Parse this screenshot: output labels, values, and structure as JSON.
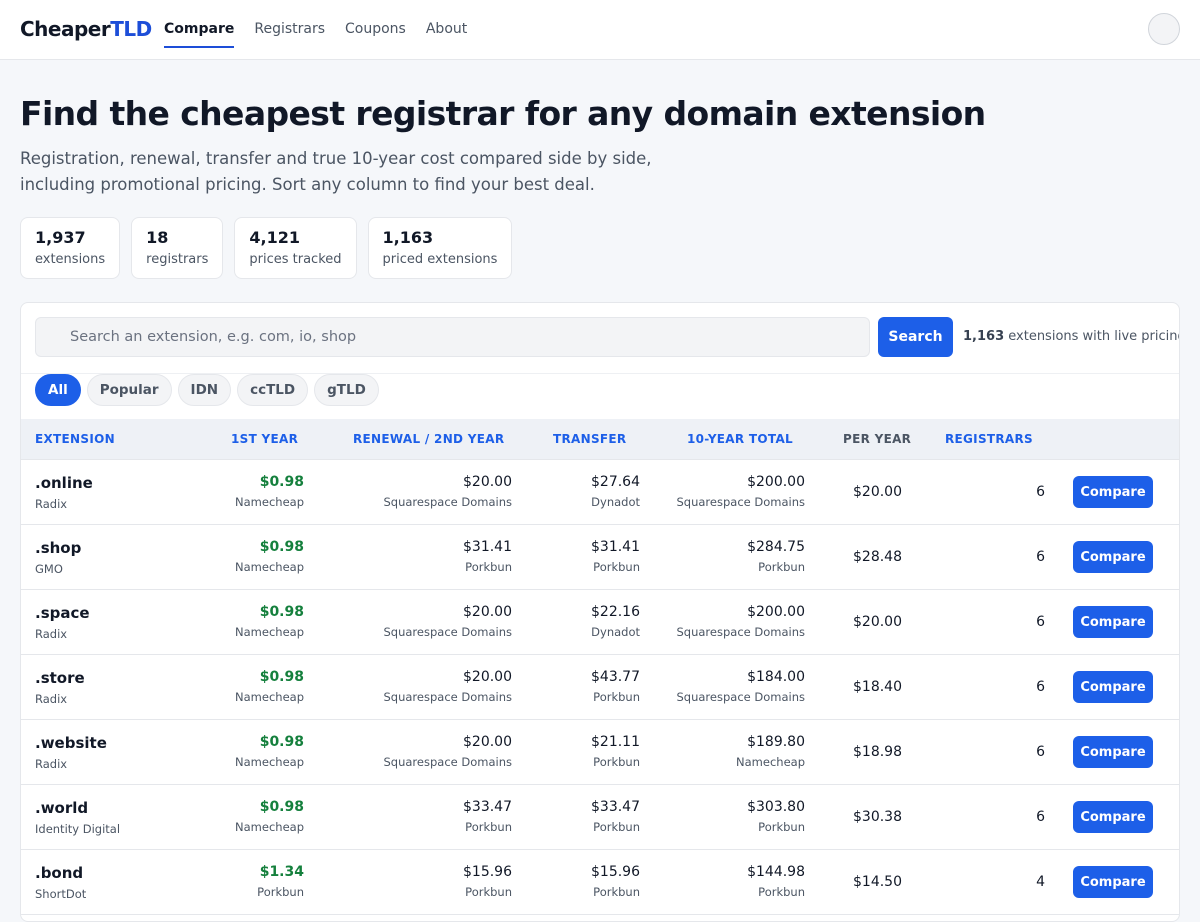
{
  "app": {
    "logo_part1": "Cheaper",
    "logo_part2": "TLD",
    "nav": [
      {
        "label": "Compare",
        "active": true
      },
      {
        "label": "Registrars",
        "active": false
      },
      {
        "label": "Coupons",
        "active": false
      },
      {
        "label": "About",
        "active": false
      }
    ]
  },
  "hero": {
    "title": "Find the cheapest registrar for any domain extension",
    "subtitle_line1": "Registration, renewal, transfer and true 10-year cost compared side by side,",
    "subtitle_line2": "including promotional pricing. Sort any column to find your best deal."
  },
  "stats": [
    {
      "value": "1,937",
      "label": "extensions"
    },
    {
      "value": "18",
      "label": "registrars"
    },
    {
      "value": "4,121",
      "label": "prices tracked"
    },
    {
      "value": "1,163",
      "label": "priced extensions"
    }
  ],
  "search": {
    "placeholder": "Search an extension, e.g. com, io, shop",
    "button_label": "Search",
    "live_count": "1,163",
    "live_text": " extensions with live pricing"
  },
  "filters": [
    {
      "label": "All",
      "active": true
    },
    {
      "label": "Popular",
      "active": false
    },
    {
      "label": "IDN",
      "active": false
    },
    {
      "label": "ccTLD",
      "active": false
    },
    {
      "label": "gTLD",
      "active": false
    }
  ],
  "table": {
    "headers": {
      "extension": "EXTENSION",
      "first_year": "1ST YEAR",
      "renewal": "RENEWAL / 2ND YEAR",
      "transfer": "TRANSFER",
      "ten_year": "10-YEAR TOTAL",
      "per_year": "PER YEAR",
      "registrars": "REGISTRARS"
    },
    "compare_label": "Compare",
    "rows": [
      {
        "ext": ".online",
        "registry": "Radix",
        "first": "$0.98",
        "first_reg": "Namecheap",
        "renew": "$20.00",
        "renew_reg": "Squarespace Domains",
        "transfer": "$27.64",
        "transfer_reg": "Dynadot",
        "ten": "$200.00",
        "ten_reg": "Squarespace Domains",
        "per_year": "$20.00",
        "registrars": "6"
      },
      {
        "ext": ".shop",
        "registry": "GMO",
        "first": "$0.98",
        "first_reg": "Namecheap",
        "renew": "$31.41",
        "renew_reg": "Porkbun",
        "transfer": "$31.41",
        "transfer_reg": "Porkbun",
        "ten": "$284.75",
        "ten_reg": "Porkbun",
        "per_year": "$28.48",
        "registrars": "6"
      },
      {
        "ext": ".space",
        "registry": "Radix",
        "first": "$0.98",
        "first_reg": "Namecheap",
        "renew": "$20.00",
        "renew_reg": "Squarespace Domains",
        "transfer": "$22.16",
        "transfer_reg": "Dynadot",
        "ten": "$200.00",
        "ten_reg": "Squarespace Domains",
        "per_year": "$20.00",
        "registrars": "6"
      },
      {
        "ext": ".store",
        "registry": "Radix",
        "first": "$0.98",
        "first_reg": "Namecheap",
        "renew": "$20.00",
        "renew_reg": "Squarespace Domains",
        "transfer": "$43.77",
        "transfer_reg": "Porkbun",
        "ten": "$184.00",
        "ten_reg": "Squarespace Domains",
        "per_year": "$18.40",
        "registrars": "6"
      },
      {
        "ext": ".website",
        "registry": "Radix",
        "first": "$0.98",
        "first_reg": "Namecheap",
        "renew": "$20.00",
        "renew_reg": "Squarespace Domains",
        "transfer": "$21.11",
        "transfer_reg": "Porkbun",
        "ten": "$189.80",
        "ten_reg": "Namecheap",
        "per_year": "$18.98",
        "registrars": "6"
      },
      {
        "ext": ".world",
        "registry": "Identity Digital",
        "first": "$0.98",
        "first_reg": "Namecheap",
        "renew": "$33.47",
        "renew_reg": "Porkbun",
        "transfer": "$33.47",
        "transfer_reg": "Porkbun",
        "ten": "$303.80",
        "ten_reg": "Porkbun",
        "per_year": "$30.38",
        "registrars": "6"
      },
      {
        "ext": ".bond",
        "registry": "ShortDot",
        "first": "$1.34",
        "first_reg": "Porkbun",
        "renew": "$15.96",
        "renew_reg": "Porkbun",
        "transfer": "$15.96",
        "transfer_reg": "Porkbun",
        "ten": "$144.98",
        "ten_reg": "Porkbun",
        "per_year": "$14.50",
        "registrars": "4"
      }
    ]
  },
  "colors": {
    "accent": "#1d5fe8",
    "price_green": "#15803d",
    "page_bg": "#f5f7fa"
  },
  "icons": {
    "search_field": "search-icon",
    "avatar": "user-avatar"
  }
}
